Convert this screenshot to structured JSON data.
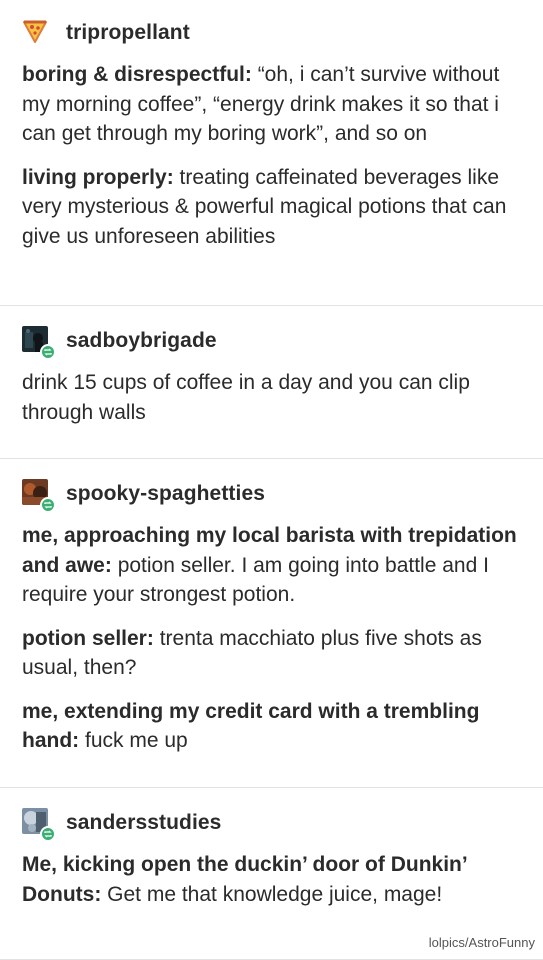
{
  "posts": [
    {
      "username": "tripropellant",
      "avatar_icon": "pizza-slice-icon",
      "paragraphs": [
        {
          "speaker": "boring & disrespectful:",
          "text": " “oh, i can’t survive without my morning coffee”, “energy drink makes it so that i can get through my boring work”, and so on"
        },
        {
          "speaker": "living properly:",
          "text": " treating caffeinated beverages like very mysterious & powerful magical potions that can give us unforeseen abilities"
        }
      ]
    },
    {
      "username": "sadboybrigade",
      "avatar_icon": "reblog-icon",
      "paragraphs": [
        {
          "speaker": "",
          "text": "drink 15 cups of coffee in a day and you can clip through walls"
        }
      ]
    },
    {
      "username": "spooky-spaghetties",
      "avatar_icon": "reblog-icon",
      "paragraphs": [
        {
          "speaker": "me, approaching my local barista with trepidation and awe:",
          "text": " potion seller. I am going into battle and I require your strongest potion."
        },
        {
          "speaker": "potion seller:",
          "text": " trenta macchiato plus five shots as usual, then?"
        },
        {
          "speaker": "me, extending my credit card with a trembling hand:",
          "text": " fuck me up"
        }
      ]
    },
    {
      "username": "sandersstudies",
      "avatar_icon": "reblog-icon",
      "paragraphs": [
        {
          "speaker": "Me, kicking open the duckin’ door of Dunkin’ Donuts:",
          "text": " Get me that knowledge juice, mage!"
        }
      ]
    }
  ],
  "watermark": "lolpics/AstroFunny",
  "colors": {
    "text": "#2b2b2b",
    "reblog_badge": "#39b072",
    "divider": "#e2e2e2",
    "pizza_crust": "#e07b39",
    "pizza_cheese": "#f5c542"
  }
}
